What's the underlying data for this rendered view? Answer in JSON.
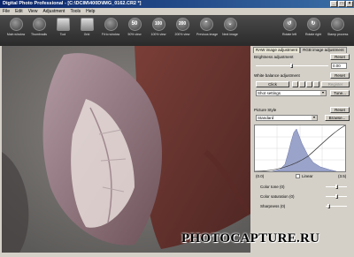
{
  "window": {
    "title": "Digital Photo Professional - [C:\\DCIM\\400D\\IMG_0162.CR2 *]"
  },
  "menu": [
    "File",
    "Edit",
    "View",
    "Adjustment",
    "Tools",
    "Help"
  ],
  "toolbar": [
    {
      "label": "Main window",
      "icon": "main-window-icon",
      "glyph": ""
    },
    {
      "label": "Thumbnails",
      "icon": "thumbnails-icon",
      "glyph": ""
    },
    {
      "label": "Tool",
      "icon": "tool-icon",
      "glyph": ""
    },
    {
      "label": "Grid",
      "icon": "grid-icon",
      "glyph": ""
    },
    {
      "label": "Fit to window",
      "icon": "fit-window-icon",
      "glyph": ""
    },
    {
      "label": "50% view",
      "icon": "zoom-50-icon",
      "glyph": "50"
    },
    {
      "label": "100% view",
      "icon": "zoom-100-icon",
      "glyph": "100"
    },
    {
      "label": "200% view",
      "icon": "zoom-200-icon",
      "glyph": "200"
    },
    {
      "label": "Previous image",
      "icon": "previous-image-icon",
      "glyph": "⌃"
    },
    {
      "label": "Next image",
      "icon": "next-image-icon",
      "glyph": "⌄"
    }
  ],
  "toolbar_right": [
    {
      "label": "Rotate left",
      "icon": "rotate-left-icon"
    },
    {
      "label": "Rotate right",
      "icon": "rotate-right-icon"
    },
    {
      "label": "Stamp process",
      "icon": "stamp-icon"
    }
  ],
  "panel": {
    "tab_raw": "RAW image adjustment",
    "tab_rgb": "RGB image adjustment",
    "brightness": {
      "label": "Brightness adjustment",
      "reset": "Reset",
      "value": "0.00"
    },
    "white_balance": {
      "label": "White balance adjustment",
      "reset": "Reset",
      "click": "Click",
      "register": "Register",
      "shot_settings": "Shot settings",
      "tune": "Tune..."
    },
    "picture_style": {
      "label": "Picture Style",
      "reset": "Reset",
      "value": "Standard",
      "browse": "Browse..."
    },
    "curve": {
      "min": "(0.0)",
      "linear": "Linear",
      "max": "(3.5)"
    },
    "color_tone": "Color tone (0)",
    "color_saturation": "Color saturation (0)",
    "sharpness": "Sharpness (0)"
  },
  "watermark": "PHOTOCAPTURE.RU"
}
